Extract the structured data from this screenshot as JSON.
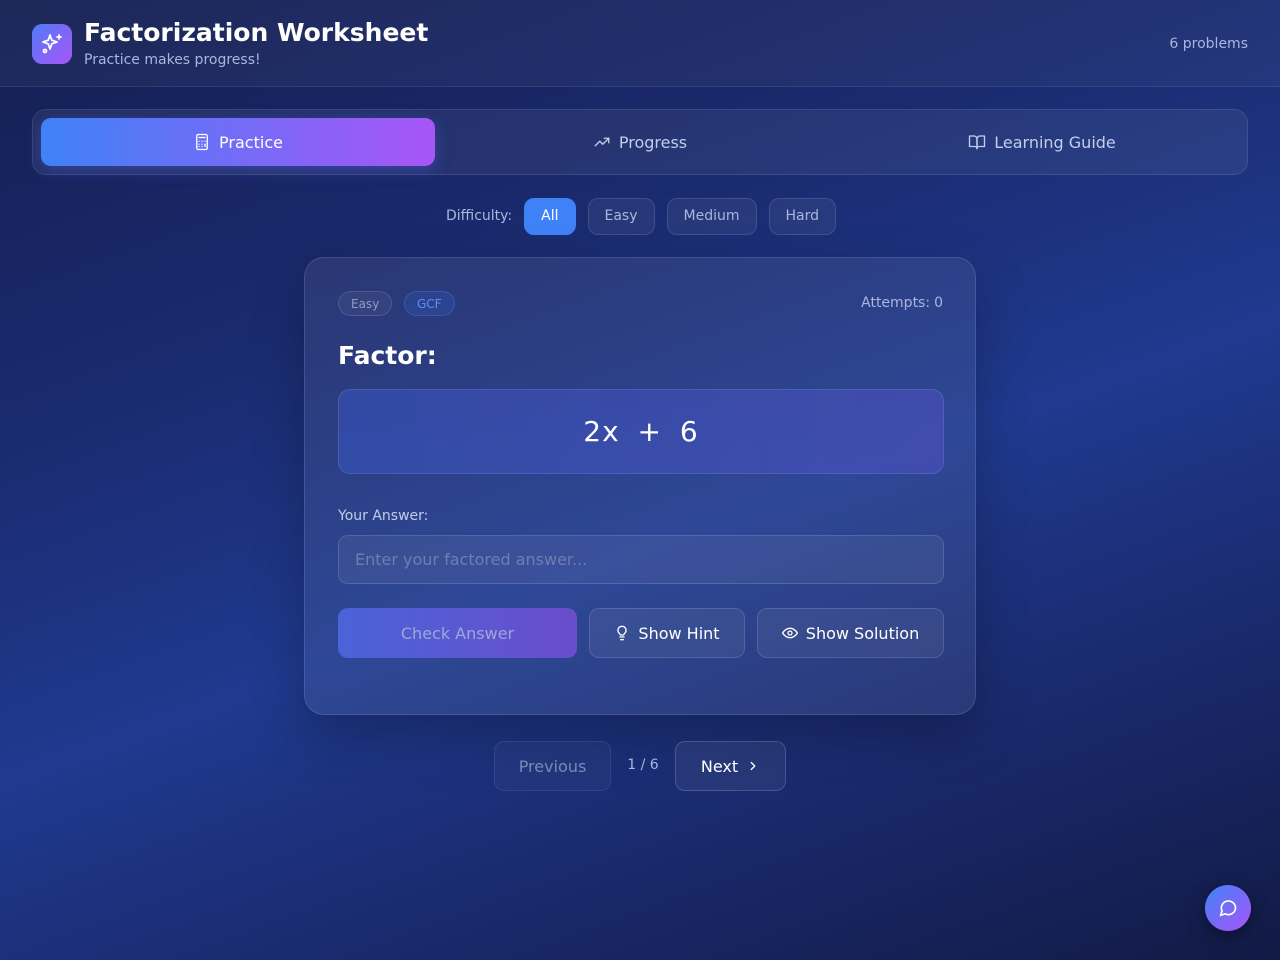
{
  "header": {
    "title": "Factorization Worksheet",
    "subtitle": "Practice makes progress!",
    "problem_count": "6 problems",
    "logo_icon": "sparkles-icon"
  },
  "tabs": [
    {
      "label": "Practice",
      "icon": "calculator-icon",
      "active": true
    },
    {
      "label": "Progress",
      "icon": "trending-up-icon",
      "active": false
    },
    {
      "label": "Learning Guide",
      "icon": "book-open-icon",
      "active": false
    }
  ],
  "difficulty": {
    "label": "Difficulty:",
    "options": [
      "All",
      "Easy",
      "Medium",
      "Hard"
    ],
    "selected": "All"
  },
  "problem": {
    "difficulty_badge": "Easy",
    "type_badge": "GCF",
    "attempts_label": "Attempts:",
    "attempts_value": "0",
    "prompt": "Factor:",
    "expression": "2x + 6",
    "answer_label": "Your Answer:",
    "answer_value": "",
    "answer_placeholder": "Enter your factored answer..."
  },
  "actions": {
    "check": "Check Answer",
    "hint": "Show Hint",
    "solution": "Show Solution"
  },
  "pagination": {
    "previous": "Previous",
    "indicator": "1 / 6",
    "next": "Next"
  },
  "colors": {
    "accent_blue": "#3f82f7",
    "accent_purple": "#a855f7",
    "background": "#1a2a6e"
  },
  "chat_fab_icon": "chat-bubble-icon"
}
